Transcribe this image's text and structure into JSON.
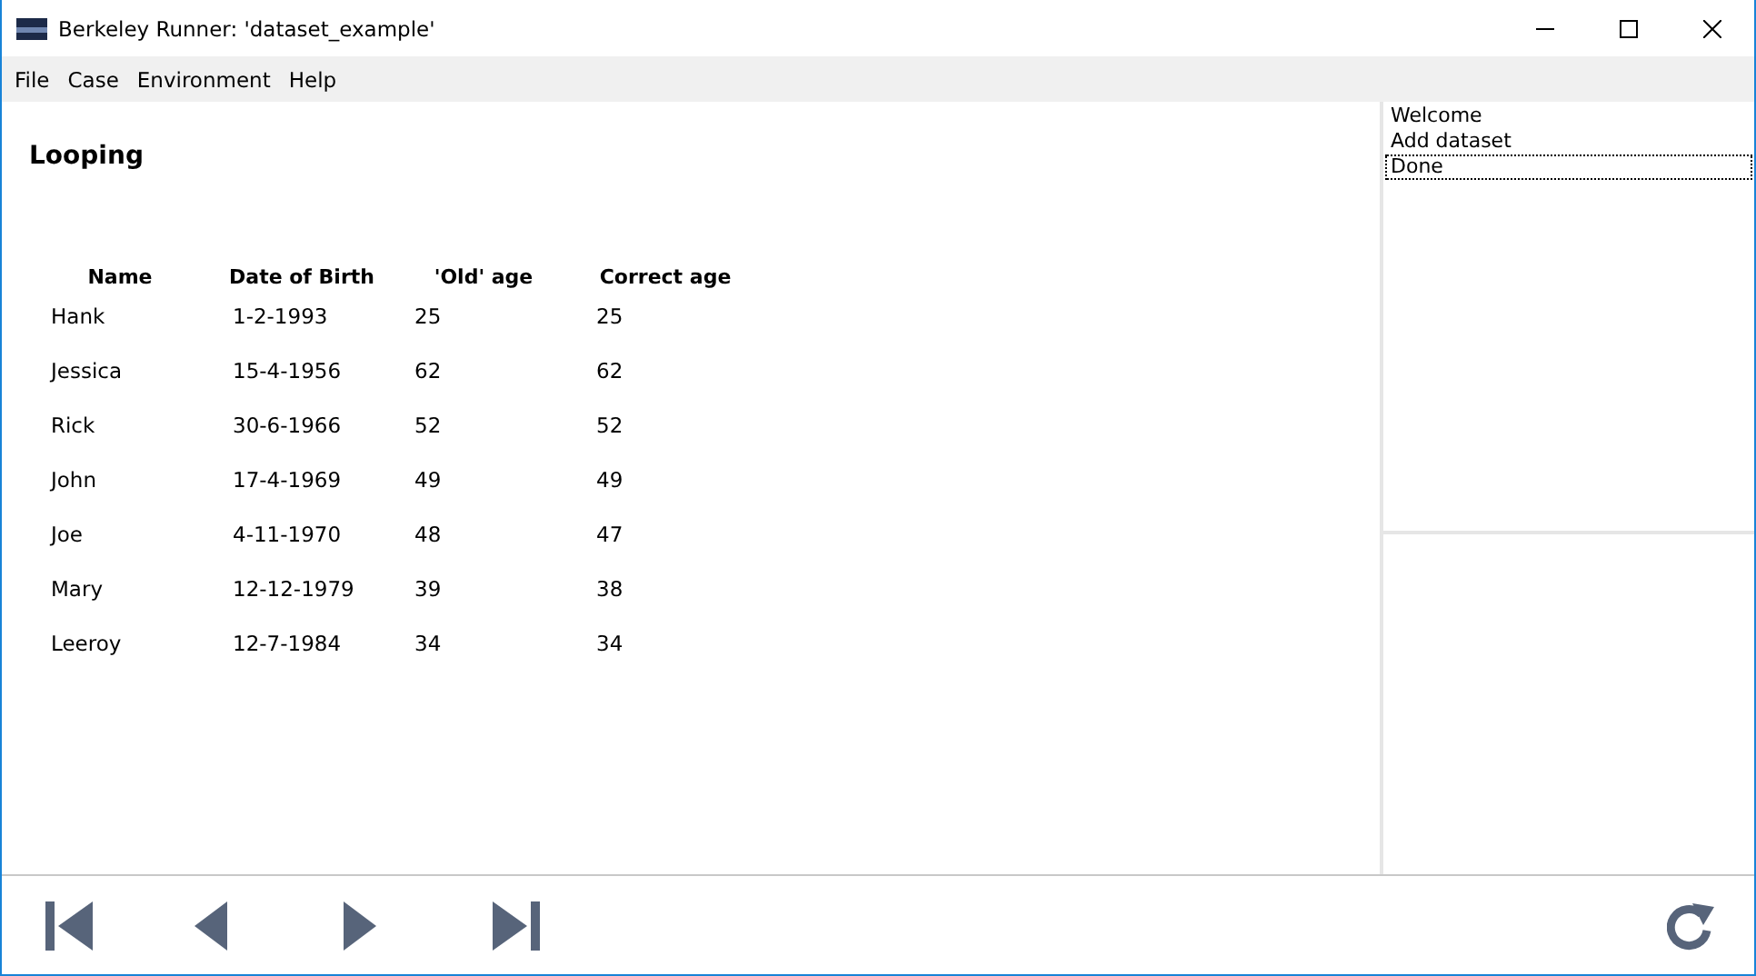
{
  "window": {
    "title": "Berkeley Runner: 'dataset_example'"
  },
  "menu": [
    "File",
    "Case",
    "Environment",
    "Help"
  ],
  "page": {
    "heading": "Looping",
    "table": {
      "columns": [
        "Name",
        "Date of Birth",
        "'Old' age",
        "Correct age"
      ],
      "rows": [
        [
          "Hank",
          "1-2-1993",
          "25",
          "25"
        ],
        [
          "Jessica",
          "15-4-1956",
          "62",
          "62"
        ],
        [
          "Rick",
          "30-6-1966",
          "52",
          "52"
        ],
        [
          "John",
          "17-4-1969",
          "49",
          "49"
        ],
        [
          "Joe",
          "4-11-1970",
          "48",
          "47"
        ],
        [
          "Mary",
          "12-12-1979",
          "39",
          "38"
        ],
        [
          "Leeroy",
          "12-7-1984",
          "34",
          "34"
        ]
      ]
    }
  },
  "steps": [
    {
      "label": "Welcome",
      "selected": false
    },
    {
      "label": "Add dataset",
      "selected": false
    },
    {
      "label": "Done",
      "selected": true
    }
  ],
  "toolbar": [
    {
      "kind": "first"
    },
    {
      "kind": "previous"
    },
    {
      "kind": "next"
    },
    {
      "kind": "last"
    },
    {
      "kind": "reload"
    }
  ]
}
